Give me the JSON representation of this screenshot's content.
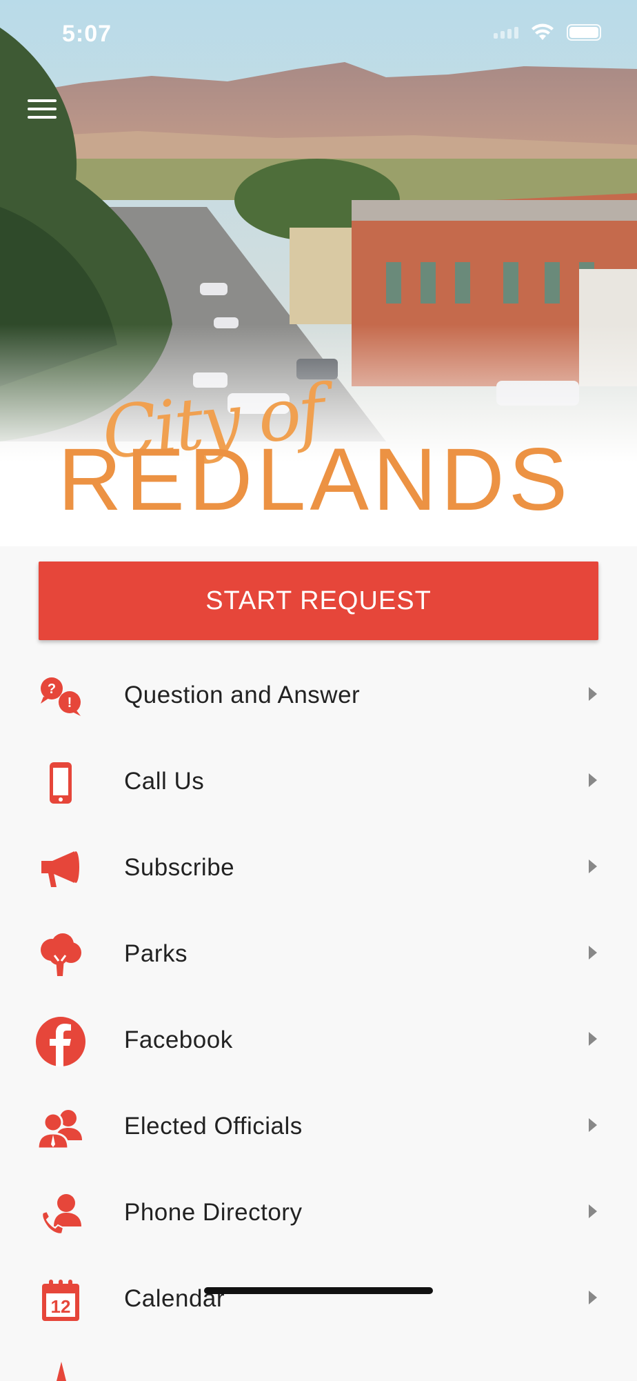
{
  "status_bar": {
    "time": "5:07"
  },
  "brand": {
    "script_text": "City of",
    "main_text": "REDLANDS"
  },
  "actions": {
    "start_request_label": "START REQUEST"
  },
  "menu_items": [
    {
      "label": "Question and Answer",
      "icon": "question-bubbles-icon"
    },
    {
      "label": "Call Us",
      "icon": "mobile-phone-icon"
    },
    {
      "label": "Subscribe",
      "icon": "megaphone-icon"
    },
    {
      "label": "Parks",
      "icon": "tree-icon"
    },
    {
      "label": "Facebook",
      "icon": "facebook-icon"
    },
    {
      "label": "Elected Officials",
      "icon": "officials-icon"
    },
    {
      "label": "Phone Directory",
      "icon": "phone-directory-icon"
    },
    {
      "label": "Calendar",
      "icon": "calendar-icon",
      "icon_number": "12"
    }
  ],
  "colors": {
    "accent": "#e6463a",
    "brand_orange": "#ec9243",
    "background": "#f8f8f8"
  }
}
